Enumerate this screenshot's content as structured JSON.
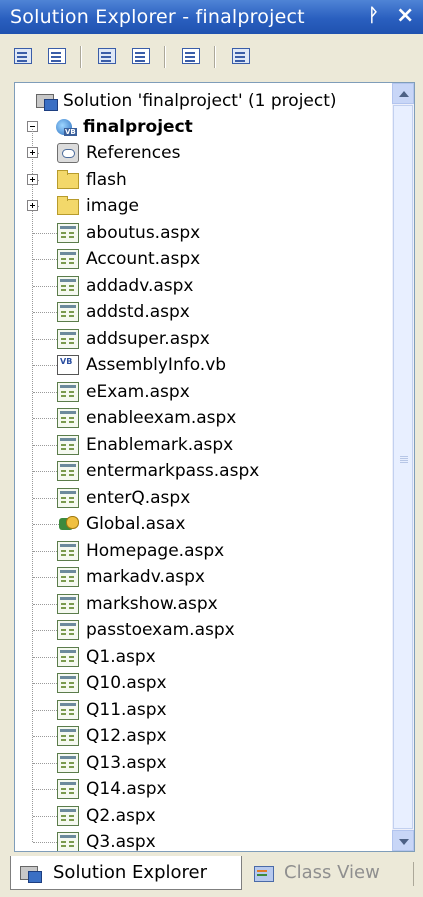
{
  "window": {
    "title": "Solution Explorer - finalproject",
    "pin_glyph": "ᚹ",
    "close_glyph": "×"
  },
  "toolbar": {
    "buttons": [
      {
        "name": "properties-icon"
      },
      {
        "name": "show-all-files-icon"
      },
      {
        "name": "refresh-icon"
      },
      {
        "name": "view-code-icon"
      },
      {
        "name": "view-designer-icon"
      },
      {
        "name": "copy-web-site-icon"
      }
    ]
  },
  "tree": {
    "solution": {
      "label": "Solution 'finalproject' (1 project)",
      "icon": "solution-icon"
    },
    "project": {
      "label": "finalproject",
      "icon": "project-icon"
    },
    "items": [
      {
        "label": "References",
        "icon": "references-icon",
        "expander": "plus"
      },
      {
        "label": "flash",
        "icon": "folder-icon",
        "expander": "plus"
      },
      {
        "label": "image",
        "icon": "folder-icon",
        "expander": "plus"
      },
      {
        "label": "aboutus.aspx",
        "icon": "aspx-page-icon"
      },
      {
        "label": "Account.aspx",
        "icon": "aspx-page-icon"
      },
      {
        "label": "addadv.aspx",
        "icon": "aspx-page-icon"
      },
      {
        "label": "addstd.aspx",
        "icon": "aspx-page-icon"
      },
      {
        "label": "addsuper.aspx",
        "icon": "aspx-page-icon"
      },
      {
        "label": "AssemblyInfo.vb",
        "icon": "vb-file-icon"
      },
      {
        "label": "eExam.aspx",
        "icon": "aspx-page-icon"
      },
      {
        "label": "enableexam.aspx",
        "icon": "aspx-page-icon"
      },
      {
        "label": "Enablemark.aspx",
        "icon": "aspx-page-icon"
      },
      {
        "label": "entermarkpass.aspx",
        "icon": "aspx-page-icon"
      },
      {
        "label": "enterQ.aspx",
        "icon": "aspx-page-icon"
      },
      {
        "label": "Global.asax",
        "icon": "global-asax-icon"
      },
      {
        "label": "Homepage.aspx",
        "icon": "aspx-page-icon"
      },
      {
        "label": "markadv.aspx",
        "icon": "aspx-page-icon"
      },
      {
        "label": "markshow.aspx",
        "icon": "aspx-page-icon"
      },
      {
        "label": "passtoexam.aspx",
        "icon": "aspx-page-icon"
      },
      {
        "label": "Q1.aspx",
        "icon": "aspx-page-icon"
      },
      {
        "label": "Q10.aspx",
        "icon": "aspx-page-icon"
      },
      {
        "label": "Q11.aspx",
        "icon": "aspx-page-icon"
      },
      {
        "label": "Q12.aspx",
        "icon": "aspx-page-icon"
      },
      {
        "label": "Q13.aspx",
        "icon": "aspx-page-icon"
      },
      {
        "label": "Q14.aspx",
        "icon": "aspx-page-icon"
      },
      {
        "label": "Q2.aspx",
        "icon": "aspx-page-icon"
      },
      {
        "label": "Q3.aspx",
        "icon": "aspx-page-icon"
      }
    ]
  },
  "tabs": {
    "active": {
      "label": "Solution Explorer",
      "icon": "solution-explorer-icon"
    },
    "inactive": {
      "label": "Class View",
      "icon": "class-view-icon"
    }
  }
}
